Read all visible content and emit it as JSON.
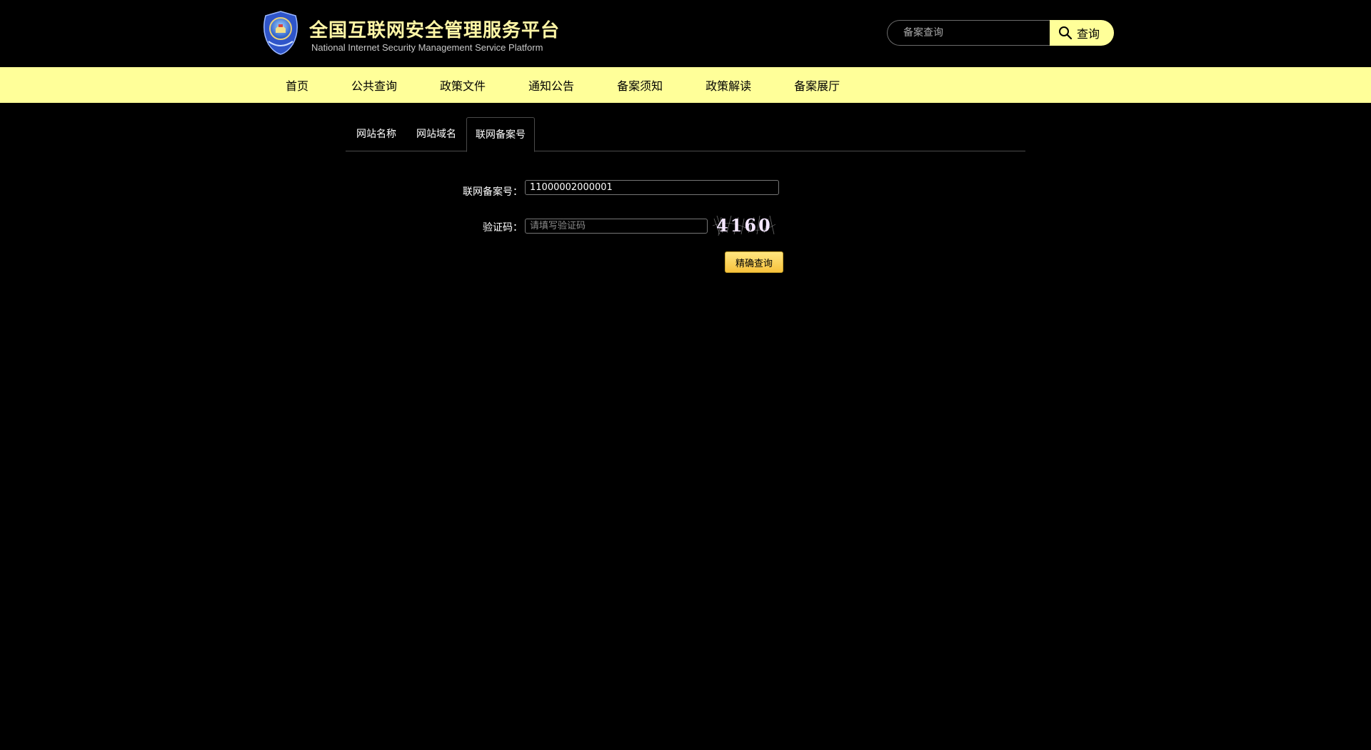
{
  "header": {
    "title": "全国互联网安全管理服务平台",
    "subtitle": "National Internet Security Management Service Platform",
    "logo_icon": "police-emblem-icon"
  },
  "search": {
    "placeholder": "备案查询",
    "button_label": "查询",
    "icon": "search-icon"
  },
  "nav": {
    "items": [
      "首页",
      "公共查询",
      "政策文件",
      "通知公告",
      "备案须知",
      "政策解读",
      "备案展厅"
    ]
  },
  "tabs": {
    "items": [
      "网站名称",
      "网站域名",
      "联网备案号"
    ],
    "active": "联网备案号"
  },
  "form": {
    "icp_label": "联网备案号：",
    "icp_value": "11000002000001",
    "captcha_label": "验证码：",
    "captcha_placeholder": "请填写验证码",
    "captcha_text": "4160",
    "submit_label": "精确查询"
  },
  "colors": {
    "background": "#000000",
    "nav_bg": "#ffff99",
    "title": "#fff6a6",
    "button_gradient_top": "#ffe680",
    "button_gradient_bottom": "#f7c23c"
  }
}
